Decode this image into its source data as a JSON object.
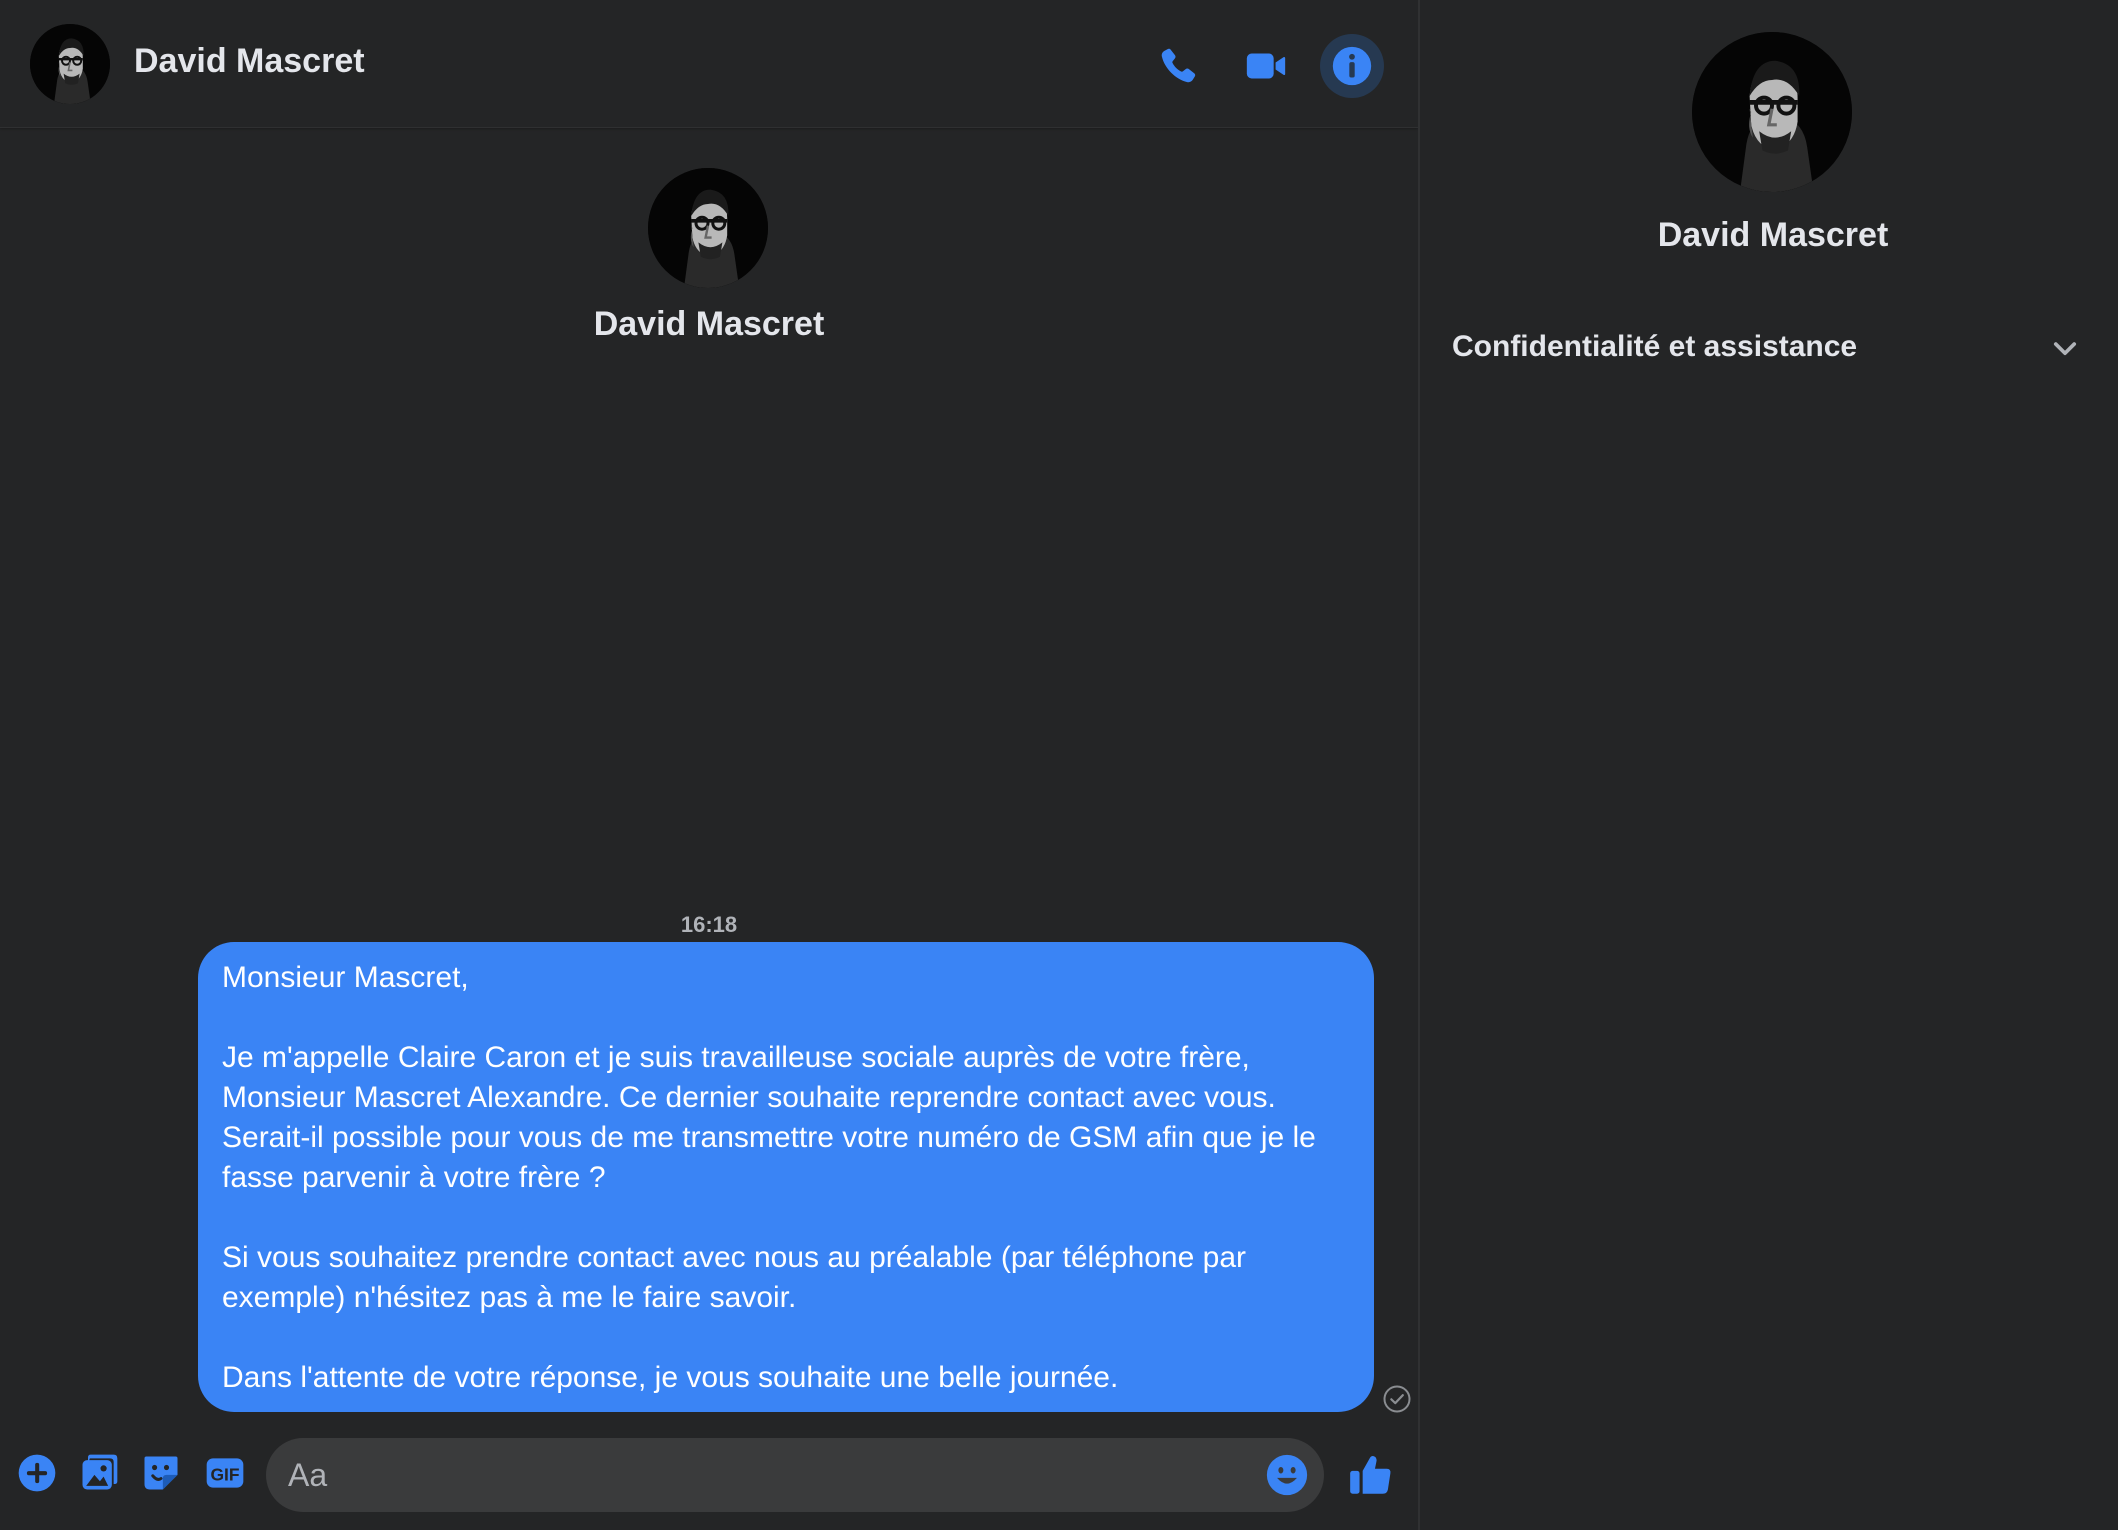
{
  "colors": {
    "accent": "#3a84f5",
    "background": "#242526",
    "input_background": "#3a3b3c",
    "text_primary": "#e4e6eb",
    "text_secondary": "#b0b3b8"
  },
  "header": {
    "contact_name": "David Mascret",
    "icons": [
      "phone-icon",
      "video-camera-icon",
      "info-icon"
    ]
  },
  "conversation": {
    "profile_name": "David Mascret",
    "timestamp": "16:18",
    "message": {
      "paragraphs": [
        "Monsieur Mascret,",
        "Je m'appelle Claire Caron et je suis travailleuse sociale auprès de votre frère, Monsieur Mascret Alexandre. Ce dernier souhaite reprendre contact avec vous. Serait-il possible pour vous de me transmettre votre numéro de GSM afin que je le fasse parvenir à votre frère ?",
        "Si vous souhaitez prendre contact avec nous au préalable (par téléphone par exemple) n'hésitez pas à me le faire savoir.",
        "Dans l'attente de votre réponse, je vous souhaite une belle journée."
      ],
      "status_icon": "sent-check-icon"
    }
  },
  "composer": {
    "placeholder": "Aa",
    "value": "",
    "icons": [
      "plus-icon",
      "image-icon",
      "sticker-icon",
      "gif-icon",
      "emoji-icon",
      "thumbs-up-icon"
    ]
  },
  "info_panel": {
    "name": "David Mascret",
    "section_label": "Confidentialité et assistance"
  }
}
